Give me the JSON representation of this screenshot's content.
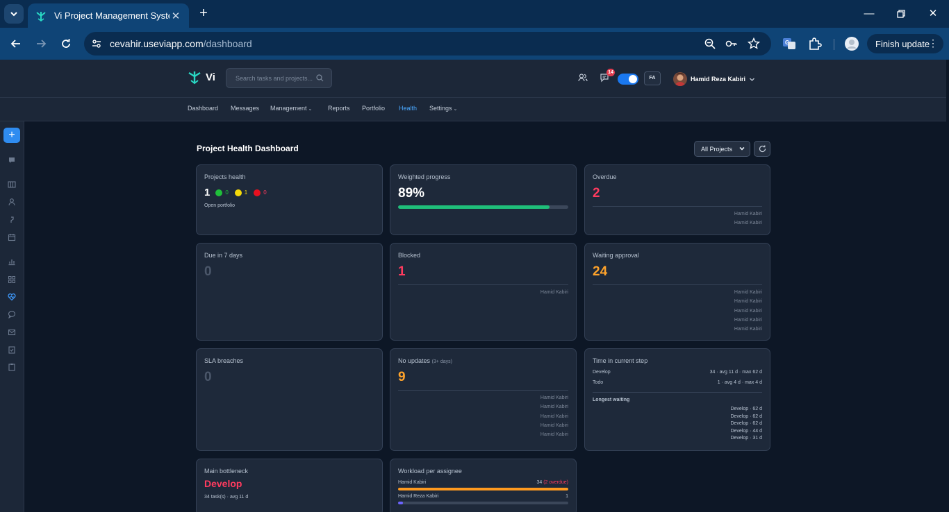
{
  "browser": {
    "tab_title": "Vi Project Management System",
    "url_host": "cevahir.useviapp.com",
    "url_path": "/dashboard",
    "finish_update_label": "Finish update"
  },
  "header": {
    "logo_text": "Vi",
    "search_placeholder": "Search tasks and projects...",
    "notification_count": "14",
    "lang_label": "FA",
    "user_name": "Hamid Reza Kabiri"
  },
  "nav": {
    "items": [
      {
        "label": "Dashboard"
      },
      {
        "label": "Messages"
      },
      {
        "label": "Management"
      },
      {
        "label": "Reports"
      },
      {
        "label": "Portfolio"
      },
      {
        "label": "Health"
      },
      {
        "label": "Settings"
      }
    ],
    "active": "Health"
  },
  "rail": {
    "icons": [
      "add-icon",
      "chat-icon",
      "board-icon",
      "user-icon",
      "hook-icon",
      "calendar-icon",
      "chart-icon",
      "grid-icon",
      "health-icon",
      "message-icon",
      "mail-icon",
      "clipboard-check-icon",
      "clipboard-icon"
    ]
  },
  "page": {
    "title": "Project Health Dashboard",
    "project_filter": "All Projects"
  },
  "cards": {
    "projects_health": {
      "title": "Projects health",
      "total": "1",
      "green": "0",
      "yellow": "1",
      "red": "0",
      "note": "Open portfolio"
    },
    "weighted_progress": {
      "title": "Weighted progress",
      "value": "89%",
      "fraction": 0.89
    },
    "overdue": {
      "title": "Overdue",
      "value": "2",
      "names": [
        "Hamid Kabiri",
        "Hamid Kabiri"
      ]
    },
    "due_7": {
      "title": "Due in 7 days",
      "value": "0"
    },
    "blocked": {
      "title": "Blocked",
      "value": "1",
      "names": [
        "Hamid Kabiri"
      ]
    },
    "waiting_approval": {
      "title": "Waiting approval",
      "value": "24",
      "names": [
        "Hamid Kabiri",
        "Hamid Kabiri",
        "Hamid Kabiri",
        "Hamid Kabiri",
        "Hamid Kabiri"
      ]
    },
    "sla": {
      "title": "SLA breaches",
      "value": "0"
    },
    "no_updates": {
      "title": "No updates",
      "sub": "(3+ days)",
      "value": "9",
      "names": [
        "Hamid Kabiri",
        "Hamid Kabiri",
        "Hamid Kabiri",
        "Hamid Kabiri",
        "Hamid Kabiri"
      ]
    },
    "time_in_step": {
      "title": "Time in current step",
      "steps": [
        {
          "name": "Develop",
          "stats": "34 · avg 11 d · max 62 d"
        },
        {
          "name": "Todo",
          "stats": "1 · avg 4 d · max 4 d"
        }
      ],
      "longest_title": "Longest waiting",
      "longest": [
        "Develop · 62 d",
        "Develop · 62 d",
        "Develop · 62 d",
        "Develop · 44 d",
        "Develop · 31 d"
      ]
    },
    "bottleneck": {
      "title": "Main bottleneck",
      "value": "Develop",
      "note": "34 task(s) · avg 11 d"
    },
    "workload": {
      "title": "Workload per assignee",
      "rows": [
        {
          "name": "Hamid Kabiri",
          "count": "34",
          "overdue": "(2 overdue)",
          "fraction": 1.0
        },
        {
          "name": "Hamid Reza Kabiri",
          "count": "1",
          "overdue": "",
          "fraction": 0.03
        }
      ]
    }
  },
  "colors": {
    "accent_blue": "#2f8cf0",
    "health_green": "#1fbf3a",
    "health_yellow": "#f5d90a",
    "health_red": "#e8101f",
    "danger": "#ff3b5f",
    "warning": "#ffa32b",
    "progress": "#1fbf7a",
    "workload_primary": "#ff9a1f",
    "workload_secondary": "#6c63ff"
  }
}
